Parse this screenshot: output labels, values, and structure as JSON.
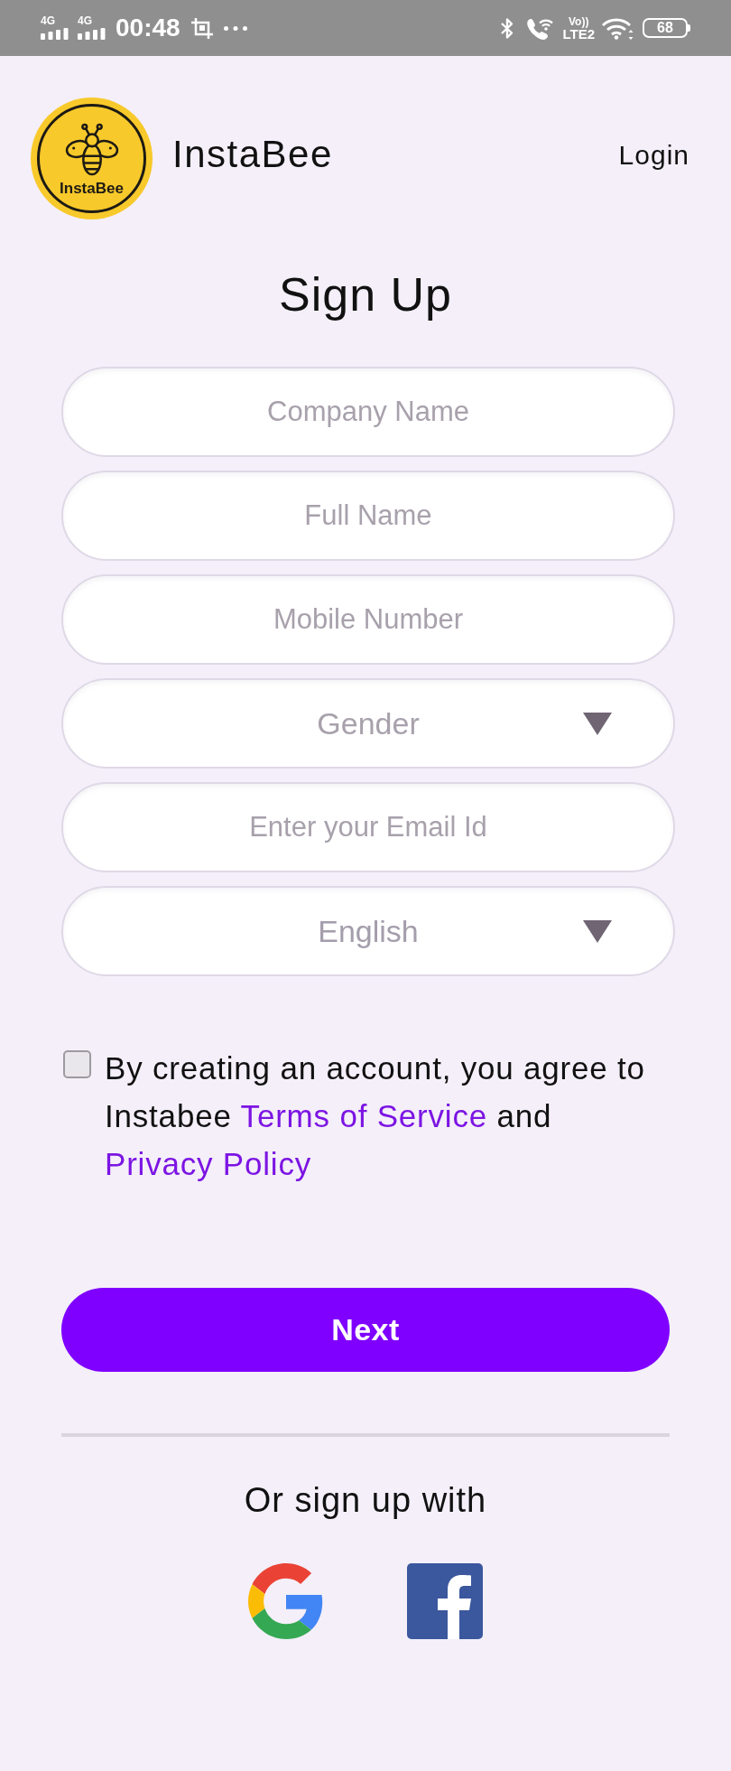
{
  "status_bar": {
    "signals": [
      {
        "network": "4G"
      },
      {
        "network": "4G"
      }
    ],
    "time": "00:48",
    "volte": {
      "top": "Vo))",
      "bottom": "LTE2"
    },
    "battery": "68"
  },
  "header": {
    "logo_text": "InstaBee",
    "app_name": "InstaBee",
    "login": "Login"
  },
  "title": "Sign Up",
  "fields": [
    {
      "kind": "input",
      "placeholder": "Company Name"
    },
    {
      "kind": "input",
      "placeholder": "Full Name"
    },
    {
      "kind": "input",
      "placeholder": "Mobile Number"
    },
    {
      "kind": "dropdown",
      "placeholder": "Gender"
    },
    {
      "kind": "input",
      "placeholder": "Enter your Email Id"
    },
    {
      "kind": "dropdown",
      "value": "English"
    }
  ],
  "agreement": {
    "checked": false,
    "parts": [
      {
        "kind": "text",
        "text": "By creating an account, you agree to Instabee "
      },
      {
        "kind": "link",
        "text": "Terms of Service"
      },
      {
        "kind": "text",
        "text": " and "
      },
      {
        "kind": "link",
        "text": "Privacy Policy"
      }
    ]
  },
  "next_button": "Next",
  "alt_signup": "Or sign up with"
}
